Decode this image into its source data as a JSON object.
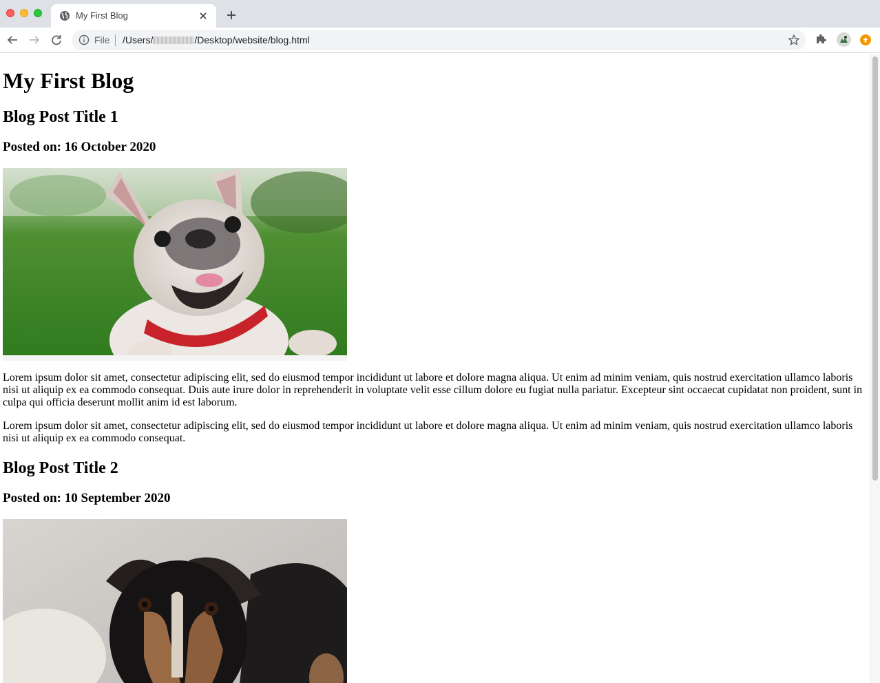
{
  "browser": {
    "tab": {
      "title": "My First Blog"
    },
    "omnibox": {
      "scheme_label": "File",
      "url_prefix": "/Users/",
      "url_suffix": "/Desktop/website/blog.html"
    },
    "icons": {
      "favicon": "globe-icon",
      "close": "close-icon",
      "new_tab": "plus-icon",
      "back": "back-arrow-icon",
      "forward": "forward-arrow-icon",
      "reload": "reload-icon",
      "info": "info-icon",
      "bookmark": "star-icon",
      "extensions": "puzzle-icon",
      "profile": "avatar",
      "update": "update-icon"
    }
  },
  "page": {
    "title": "My First Blog",
    "posts": [
      {
        "title": "Blog Post Title 1",
        "date": "Posted on: 16 October 2020",
        "image": "french-bulldog-photo",
        "paragraphs": [
          "Lorem ipsum dolor sit amet, consectetur adipiscing elit, sed do eiusmod tempor incididunt ut labore et dolore magna aliqua. Ut enim ad minim veniam, quis nostrud exercitation ullamco laboris nisi ut aliquip ex ea commodo consequat. Duis aute irure dolor in reprehenderit in voluptate velit esse cillum dolore eu fugiat nulla pariatur. Excepteur sint occaecat cupidatat non proident, sunt in culpa qui officia deserunt mollit anim id est laborum.",
          "Lorem ipsum dolor sit amet, consectetur adipiscing elit, sed do eiusmod tempor incididunt ut labore et dolore magna aliqua. Ut enim ad minim veniam, quis nostrud exercitation ullamco laboris nisi ut aliquip ex ea commodo consequat."
        ]
      },
      {
        "title": "Blog Post Title 2",
        "date": "Posted on: 10 September 2020",
        "image": "terrier-dog-photo"
      }
    ]
  }
}
